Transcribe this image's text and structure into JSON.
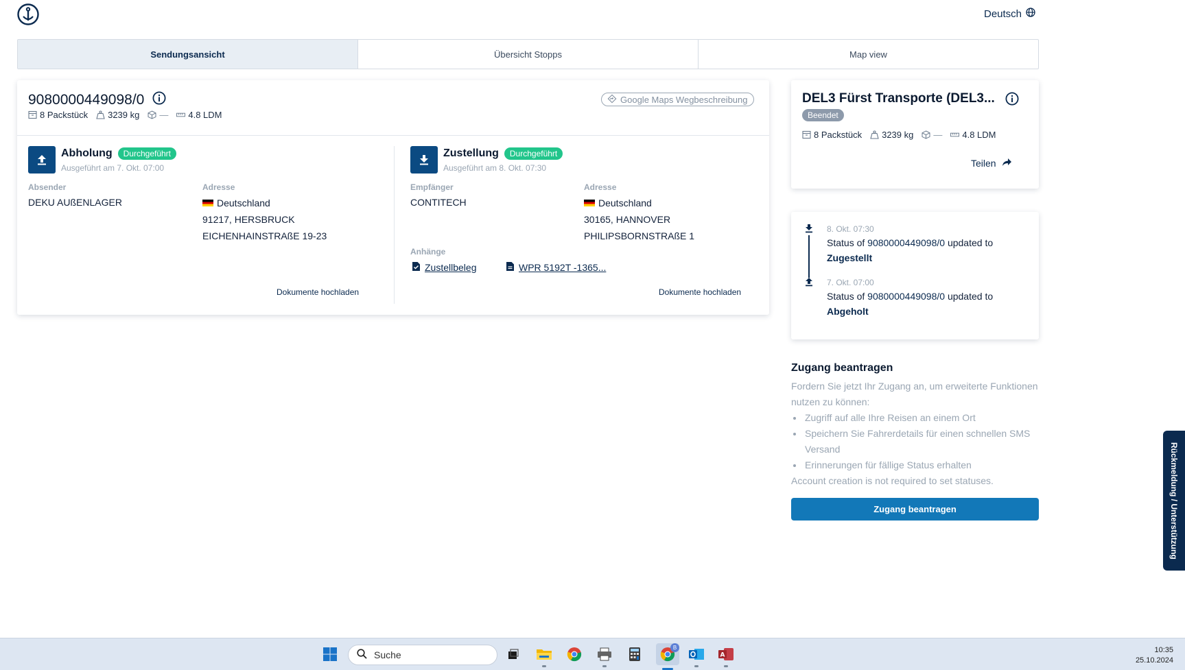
{
  "header": {
    "language": "Deutsch"
  },
  "tabs": [
    {
      "label": "Sendungsansicht",
      "active": true
    },
    {
      "label": "Übersicht Stopps",
      "active": false
    },
    {
      "label": "Map view",
      "active": false
    }
  ],
  "shipment": {
    "id": "9080000449098/0",
    "packages": "8 Packstück",
    "weight": "3239 kg",
    "volume": "—",
    "ldm": "4.8 LDM",
    "google_maps": "Google Maps Wegbeschreibung"
  },
  "pickup": {
    "title": "Abholung",
    "status": "Durchgeführt",
    "executed": "Ausgeführt am 7. Okt. 07:00",
    "party_label": "Absender",
    "party": "DEKU AUßENLAGER",
    "address_label": "Adresse",
    "country": "Deutschland",
    "city": "91217, HERSBRUCK",
    "street": "EICHENHAINSTRAßE 19-23",
    "upload": "Dokumente hochladen"
  },
  "delivery": {
    "title": "Zustellung",
    "status": "Durchgeführt",
    "executed": "Ausgeführt am 8. Okt. 07:30",
    "party_label": "Empfänger",
    "party": "CONTITECH",
    "address_label": "Adresse",
    "country": "Deutschland",
    "city": "30165, HANNOVER",
    "street": "PHILIPSBORNSTRAßE 1",
    "attachments_label": "Anhänge",
    "attachments": [
      "Zustellbeleg",
      "WPR 5192T -1365..."
    ],
    "upload": "Dokumente hochladen"
  },
  "carrier": {
    "name": "DEL3 Fürst Transporte (DEL3...",
    "status": "Beendet",
    "packages": "8 Packstück",
    "weight": "3239 kg",
    "volume": "—",
    "ldm": "4.8 LDM",
    "share": "Teilen"
  },
  "timeline": [
    {
      "date": "8. Okt. 07:30",
      "prefix": "Status of",
      "ref": "9080000449098/0",
      "mid": "updated to",
      "status": "Zugestellt"
    },
    {
      "date": "7. Okt. 07:00",
      "prefix": "Status of",
      "ref": "9080000449098/0",
      "mid": "updated to",
      "status": "Abgeholt"
    }
  ],
  "access": {
    "title": "Zugang beantragen",
    "intro": "Fordern Sie jetzt Ihr Zugang an, um erweiterte Funktionen nutzen zu können:",
    "bullets": [
      "Zugriff auf alle Ihre Reisen an einem Ort",
      "Speichern Sie Fahrerdetails für einen schnellen SMS Versand",
      "Erinnerungen für fällige Status erhalten"
    ],
    "note": "Account creation is not required to set statuses.",
    "button": "Zugang beantragen"
  },
  "feedback": "Rückmeldung / Unterstützung",
  "taskbar": {
    "search_placeholder": "Suche",
    "chrome_badge": "B",
    "time": "10:35",
    "date": "25.10.2024"
  }
}
